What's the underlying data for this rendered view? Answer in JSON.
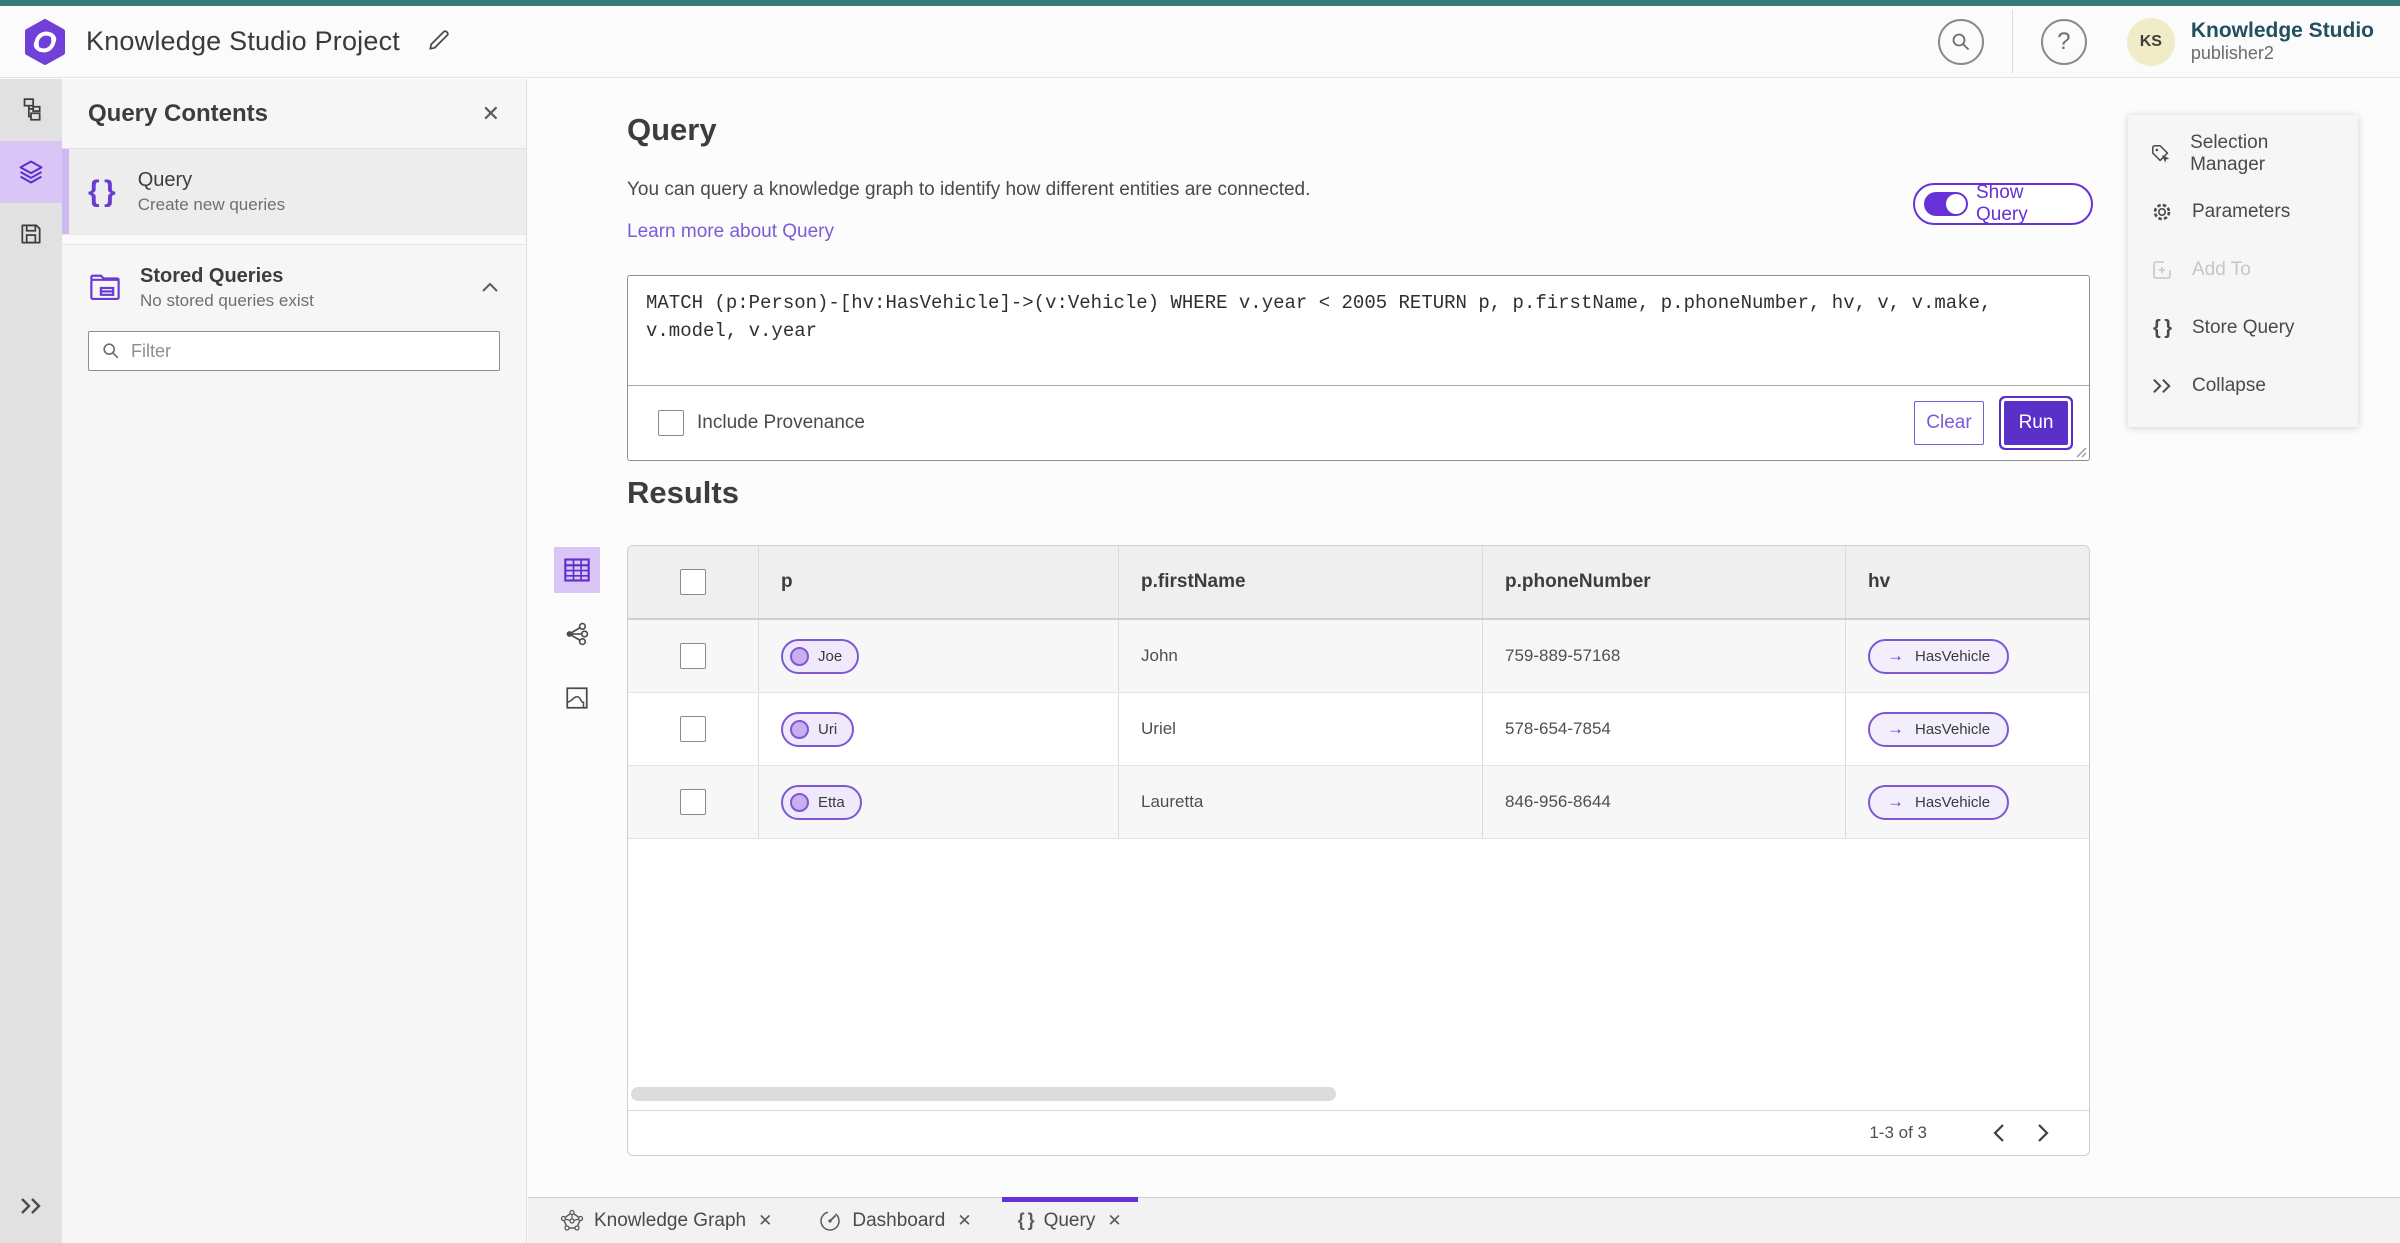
{
  "header": {
    "project_title": "Knowledge Studio Project",
    "product_name": "Knowledge Studio",
    "user_name": "publisher2",
    "avatar_initials": "KS"
  },
  "query_contents": {
    "title": "Query Contents",
    "query_item": {
      "title": "Query",
      "description": "Create new queries"
    },
    "stored_queries": {
      "title": "Stored Queries",
      "description": "No stored queries exist"
    },
    "filter_placeholder": "Filter"
  },
  "query_panel": {
    "title": "Query",
    "description": "You can query a knowledge graph to identify how different entities are connected.",
    "learn_more": "Learn more about Query",
    "show_query_label": "Show Query",
    "query_text": "MATCH (p:Person)-[hv:HasVehicle]->(v:Vehicle) WHERE v.year < 2005 RETURN p, p.firstName, p.phoneNumber, hv, v, v.make, v.model, v.year",
    "include_provenance_label": "Include Provenance",
    "clear_label": "Clear",
    "run_label": "Run"
  },
  "results": {
    "title": "Results",
    "columns": [
      "p",
      "p.firstName",
      "p.phoneNumber",
      "hv"
    ],
    "rows": [
      {
        "p": "Joe",
        "firstName": "John",
        "phoneNumber": "759-889-57168",
        "hv": "HasVehicle"
      },
      {
        "p": "Uri",
        "firstName": "Uriel",
        "phoneNumber": "578-654-7854",
        "hv": "HasVehicle"
      },
      {
        "p": "Etta",
        "firstName": "Lauretta",
        "phoneNumber": "846-956-8644",
        "hv": "HasVehicle"
      }
    ],
    "pagination": "1-3 of 3"
  },
  "right_panel": {
    "items": [
      {
        "label": "Selection Manager",
        "disabled": false
      },
      {
        "label": "Parameters",
        "disabled": false
      },
      {
        "label": "Add To",
        "disabled": true
      },
      {
        "label": "Store Query",
        "disabled": false
      },
      {
        "label": "Collapse",
        "disabled": false
      }
    ]
  },
  "tabs": [
    {
      "label": "Knowledge Graph",
      "active": false
    },
    {
      "label": "Dashboard",
      "active": false
    },
    {
      "label": "Query",
      "active": true
    }
  ],
  "icons": {
    "braces": "{ }",
    "close": "✕",
    "question": "?",
    "arrow_right": "→"
  },
  "colors": {
    "accent_purple": "#6731d8",
    "run_button": "#5b30c9",
    "selected_purple_bg": "#d9c6f6",
    "pill_bg": "#efe9fb",
    "pill_border": "#7e57d2",
    "teal_top_strip": "#377879",
    "avatar_bg": "#f1ecc8",
    "link_purple": "#7a5cd8"
  }
}
